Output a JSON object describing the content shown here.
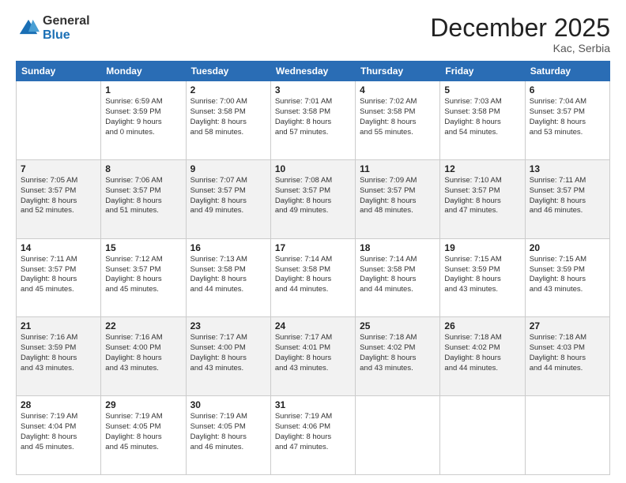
{
  "header": {
    "logo_line1": "General",
    "logo_line2": "Blue",
    "month": "December 2025",
    "location": "Kac, Serbia"
  },
  "weekdays": [
    "Sunday",
    "Monday",
    "Tuesday",
    "Wednesday",
    "Thursday",
    "Friday",
    "Saturday"
  ],
  "rows": [
    [
      {
        "day": "",
        "content": ""
      },
      {
        "day": "1",
        "content": "Sunrise: 6:59 AM\nSunset: 3:59 PM\nDaylight: 9 hours\nand 0 minutes."
      },
      {
        "day": "2",
        "content": "Sunrise: 7:00 AM\nSunset: 3:58 PM\nDaylight: 8 hours\nand 58 minutes."
      },
      {
        "day": "3",
        "content": "Sunrise: 7:01 AM\nSunset: 3:58 PM\nDaylight: 8 hours\nand 57 minutes."
      },
      {
        "day": "4",
        "content": "Sunrise: 7:02 AM\nSunset: 3:58 PM\nDaylight: 8 hours\nand 55 minutes."
      },
      {
        "day": "5",
        "content": "Sunrise: 7:03 AM\nSunset: 3:58 PM\nDaylight: 8 hours\nand 54 minutes."
      },
      {
        "day": "6",
        "content": "Sunrise: 7:04 AM\nSunset: 3:57 PM\nDaylight: 8 hours\nand 53 minutes."
      }
    ],
    [
      {
        "day": "7",
        "content": "Sunrise: 7:05 AM\nSunset: 3:57 PM\nDaylight: 8 hours\nand 52 minutes."
      },
      {
        "day": "8",
        "content": "Sunrise: 7:06 AM\nSunset: 3:57 PM\nDaylight: 8 hours\nand 51 minutes."
      },
      {
        "day": "9",
        "content": "Sunrise: 7:07 AM\nSunset: 3:57 PM\nDaylight: 8 hours\nand 49 minutes."
      },
      {
        "day": "10",
        "content": "Sunrise: 7:08 AM\nSunset: 3:57 PM\nDaylight: 8 hours\nand 49 minutes."
      },
      {
        "day": "11",
        "content": "Sunrise: 7:09 AM\nSunset: 3:57 PM\nDaylight: 8 hours\nand 48 minutes."
      },
      {
        "day": "12",
        "content": "Sunrise: 7:10 AM\nSunset: 3:57 PM\nDaylight: 8 hours\nand 47 minutes."
      },
      {
        "day": "13",
        "content": "Sunrise: 7:11 AM\nSunset: 3:57 PM\nDaylight: 8 hours\nand 46 minutes."
      }
    ],
    [
      {
        "day": "14",
        "content": "Sunrise: 7:11 AM\nSunset: 3:57 PM\nDaylight: 8 hours\nand 45 minutes."
      },
      {
        "day": "15",
        "content": "Sunrise: 7:12 AM\nSunset: 3:57 PM\nDaylight: 8 hours\nand 45 minutes."
      },
      {
        "day": "16",
        "content": "Sunrise: 7:13 AM\nSunset: 3:58 PM\nDaylight: 8 hours\nand 44 minutes."
      },
      {
        "day": "17",
        "content": "Sunrise: 7:14 AM\nSunset: 3:58 PM\nDaylight: 8 hours\nand 44 minutes."
      },
      {
        "day": "18",
        "content": "Sunrise: 7:14 AM\nSunset: 3:58 PM\nDaylight: 8 hours\nand 44 minutes."
      },
      {
        "day": "19",
        "content": "Sunrise: 7:15 AM\nSunset: 3:59 PM\nDaylight: 8 hours\nand 43 minutes."
      },
      {
        "day": "20",
        "content": "Sunrise: 7:15 AM\nSunset: 3:59 PM\nDaylight: 8 hours\nand 43 minutes."
      }
    ],
    [
      {
        "day": "21",
        "content": "Sunrise: 7:16 AM\nSunset: 3:59 PM\nDaylight: 8 hours\nand 43 minutes."
      },
      {
        "day": "22",
        "content": "Sunrise: 7:16 AM\nSunset: 4:00 PM\nDaylight: 8 hours\nand 43 minutes."
      },
      {
        "day": "23",
        "content": "Sunrise: 7:17 AM\nSunset: 4:00 PM\nDaylight: 8 hours\nand 43 minutes."
      },
      {
        "day": "24",
        "content": "Sunrise: 7:17 AM\nSunset: 4:01 PM\nDaylight: 8 hours\nand 43 minutes."
      },
      {
        "day": "25",
        "content": "Sunrise: 7:18 AM\nSunset: 4:02 PM\nDaylight: 8 hours\nand 43 minutes."
      },
      {
        "day": "26",
        "content": "Sunrise: 7:18 AM\nSunset: 4:02 PM\nDaylight: 8 hours\nand 44 minutes."
      },
      {
        "day": "27",
        "content": "Sunrise: 7:18 AM\nSunset: 4:03 PM\nDaylight: 8 hours\nand 44 minutes."
      }
    ],
    [
      {
        "day": "28",
        "content": "Sunrise: 7:19 AM\nSunset: 4:04 PM\nDaylight: 8 hours\nand 45 minutes."
      },
      {
        "day": "29",
        "content": "Sunrise: 7:19 AM\nSunset: 4:05 PM\nDaylight: 8 hours\nand 45 minutes."
      },
      {
        "day": "30",
        "content": "Sunrise: 7:19 AM\nSunset: 4:05 PM\nDaylight: 8 hours\nand 46 minutes."
      },
      {
        "day": "31",
        "content": "Sunrise: 7:19 AM\nSunset: 4:06 PM\nDaylight: 8 hours\nand 47 minutes."
      },
      {
        "day": "",
        "content": ""
      },
      {
        "day": "",
        "content": ""
      },
      {
        "day": "",
        "content": ""
      }
    ]
  ]
}
